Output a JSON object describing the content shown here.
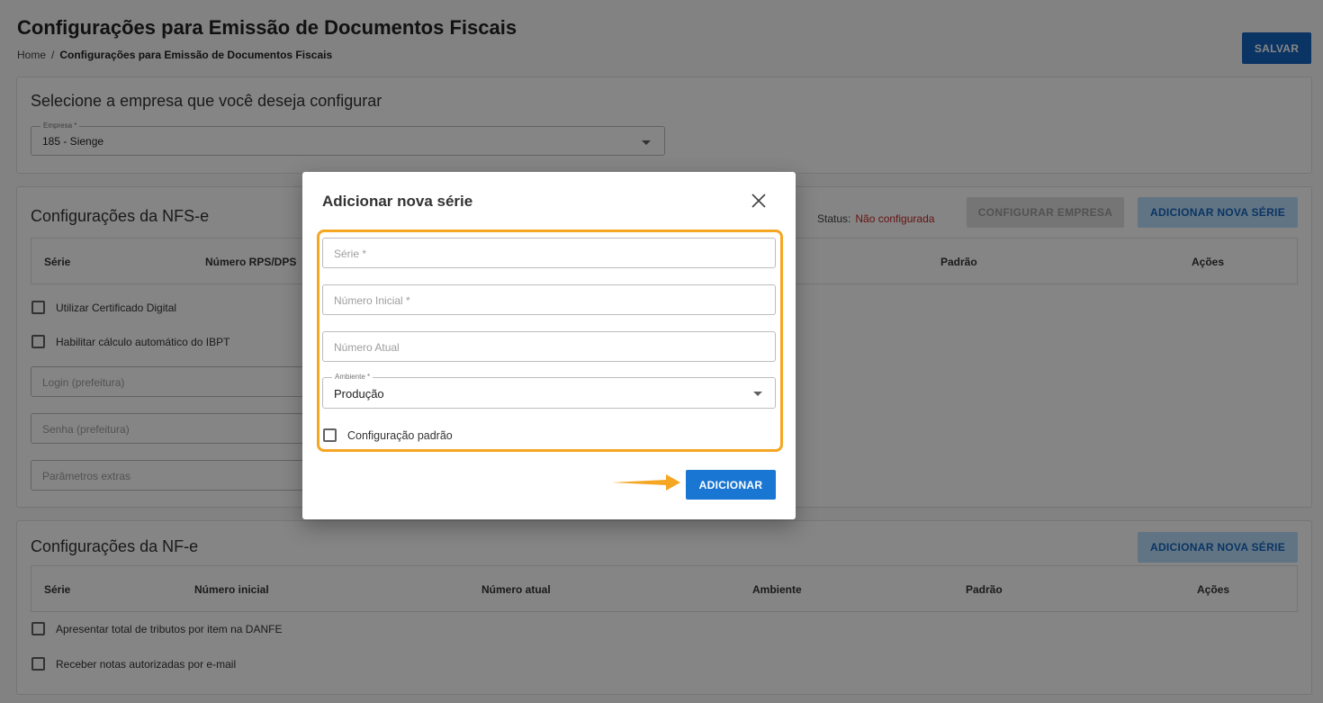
{
  "header": {
    "title": "Configurações para Emissão de Documentos Fiscais",
    "breadcrumb_home": "Home",
    "breadcrumb_separator": "/",
    "breadcrumb_current": "Configurações para Emissão de Documentos Fiscais",
    "save_label": "SALVAR"
  },
  "company_card": {
    "title": "Selecione a empresa que você deseja configurar",
    "field_label": "Empresa *",
    "field_value": "185 - Sienge"
  },
  "nfse_card": {
    "title": "Configurações da NFS-e",
    "status_label": "Status:",
    "status_value": "Não configurada",
    "configure_label": "CONFIGURAR EMPRESA",
    "add_series_label": "ADICIONAR NOVA SÉRIE",
    "columns": [
      "Série",
      "Número RPS/DPS",
      "Padrão",
      "Ações"
    ],
    "checkboxes": [
      "Utilizar Certificado Digital",
      "Habilitar cálculo automático do IBPT"
    ],
    "fields": [
      "Login (prefeitura)",
      "Senha (prefeitura)",
      "Parâmetros extras"
    ]
  },
  "nfe_card": {
    "title": "Configurações da NF-e",
    "add_series_label": "ADICIONAR NOVA SÉRIE",
    "columns": [
      "Série",
      "Número inicial",
      "Número atual",
      "Ambiente",
      "Padrão",
      "Ações"
    ],
    "checkboxes": [
      "Apresentar total de tributos por item na DANFE",
      "Receber notas autorizadas por e-mail"
    ]
  },
  "modal": {
    "title": "Adicionar nova série",
    "close_icon": "close-icon",
    "serie_placeholder": "Série *",
    "numero_inicial_placeholder": "Número Inicial *",
    "numero_atual_placeholder": "Número Atual",
    "ambiente_label": "Ambiente *",
    "ambiente_value": "Produção",
    "default_config_label": "Configuração padrão",
    "add_label": "ADICIONAR"
  },
  "colors": {
    "primary": "#1565c0",
    "highlight": "#f5a623",
    "status_error": "#c62828"
  }
}
